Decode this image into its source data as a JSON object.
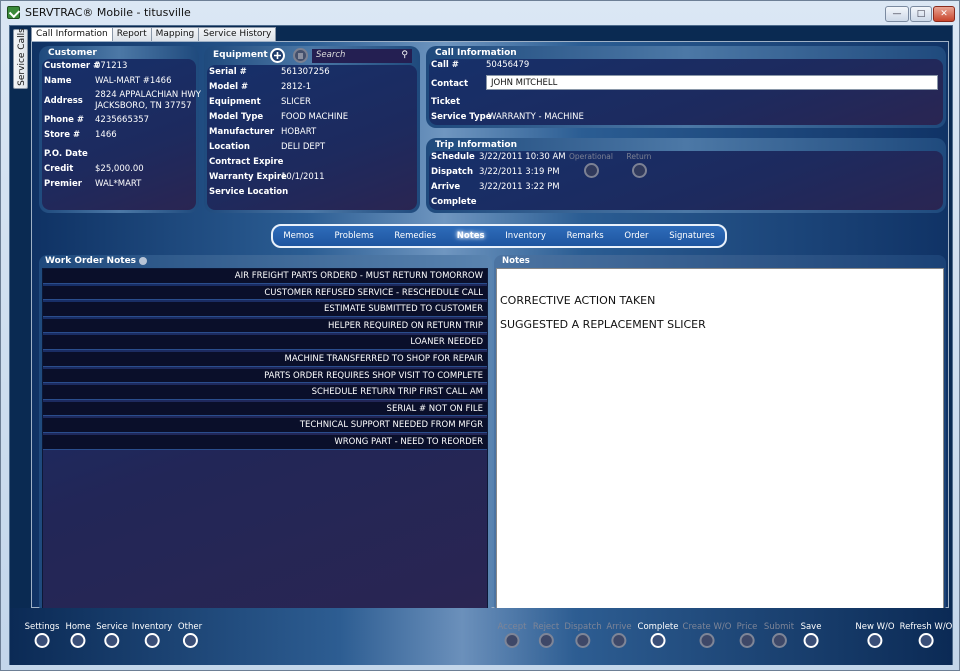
{
  "window": {
    "title": "SERVTRAC® Mobile - titusville",
    "controls": {
      "minimize": "—",
      "maximize": "□",
      "close": "✕"
    }
  },
  "side_tab": "Service Calls",
  "tabs": [
    {
      "label": "Call Information",
      "active": true
    },
    {
      "label": "Report",
      "active": false
    },
    {
      "label": "Mapping",
      "active": false
    },
    {
      "label": "Service History",
      "active": false
    }
  ],
  "customer": {
    "title": "Customer",
    "fields": [
      {
        "label": "Customer #",
        "value": "071213"
      },
      {
        "label": "Name",
        "value": "WAL-MART #1466"
      },
      {
        "label": "Address",
        "value": "2824 APPALACHIAN HWY",
        "value2": "JACKSBORO, TN 37757"
      },
      {
        "label": "Phone #",
        "value": "4235665357"
      },
      {
        "label": "Store #",
        "value": "1466"
      },
      {
        "label": "P.O. Date",
        "value": ""
      },
      {
        "label": "Credit",
        "value": "$25,000.00"
      },
      {
        "label": "Premier",
        "value": "WAL*MART"
      }
    ]
  },
  "equipment": {
    "title": "Equipment",
    "search_placeholder": "Search",
    "fields": [
      {
        "label": "Serial #",
        "value": "561307256"
      },
      {
        "label": "Model #",
        "value": "2812-1"
      },
      {
        "label": "Equipment",
        "value": "SLICER"
      },
      {
        "label": "Model Type",
        "value": "FOOD MACHINE"
      },
      {
        "label": "Manufacturer",
        "value": "HOBART"
      },
      {
        "label": "Location",
        "value": "DELI DEPT"
      },
      {
        "label": "Contract Expire",
        "value": ""
      },
      {
        "label": "Warranty Expire",
        "value": "10/1/2011"
      },
      {
        "label": "Service Location",
        "value": ""
      }
    ]
  },
  "call_information": {
    "title": "Call Information",
    "call_label": "Call #",
    "call_value": "50456479",
    "contact_label": "Contact",
    "contact_value": "JOHN MITCHELL",
    "ticket_label": "Ticket",
    "ticket_value": "",
    "service_type_label": "Service Type",
    "service_type_value": "WARRANTY - MACHINE"
  },
  "trip_information": {
    "title": "Trip Information",
    "fields": [
      {
        "label": "Schedule",
        "value": "3/22/2011 10:30 AM"
      },
      {
        "label": "Dispatch",
        "value": "3/22/2011 3:19 PM"
      },
      {
        "label": "Arrive",
        "value": "3/22/2011 3:22 PM"
      },
      {
        "label": "Complete",
        "value": ""
      }
    ],
    "operational_label": "Operational",
    "return_label": "Return"
  },
  "subnav": [
    {
      "label": "Memos",
      "active": false
    },
    {
      "label": "Problems",
      "active": false
    },
    {
      "label": "Remedies",
      "active": false
    },
    {
      "label": "Notes",
      "active": true
    },
    {
      "label": "Inventory",
      "active": false
    },
    {
      "label": "Remarks",
      "active": false
    },
    {
      "label": "Order",
      "active": false
    },
    {
      "label": "Signatures",
      "active": false
    }
  ],
  "work_order_notes": {
    "title": "Work Order Notes",
    "items": [
      "AIR FREIGHT PARTS ORDERD - MUST RETURN TOMORROW",
      "CUSTOMER REFUSED SERVICE - RESCHEDULE CALL",
      "ESTIMATE SUBMITTED TO CUSTOMER",
      "HELPER REQUIRED ON RETURN TRIP",
      "LOANER NEEDED",
      "MACHINE TRANSFERRED TO SHOP FOR REPAIR",
      "PARTS ORDER REQUIRES SHOP VISIT TO COMPLETE",
      "SCHEDULE RETURN TRIP FIRST CALL AM",
      "SERIAL # NOT ON FILE",
      "TECHNICAL SUPPORT NEEDED FROM MFGR",
      "WRONG PART - NEED TO REORDER"
    ]
  },
  "notes": {
    "title": "Notes",
    "lines": [
      "CORRECTIVE ACTION TAKEN",
      "SUGGESTED A REPLACEMENT SLICER"
    ]
  },
  "toolbar": {
    "left": [
      {
        "label": "Settings",
        "icon": "settings-icon"
      },
      {
        "label": "Home",
        "icon": "home-icon"
      },
      {
        "label": "Service",
        "icon": "service-icon"
      },
      {
        "label": "Inventory",
        "icon": "inventory-icon"
      },
      {
        "label": "Other",
        "icon": "other-icon"
      }
    ],
    "right": [
      {
        "label": "Accept",
        "enabled": false
      },
      {
        "label": "Reject",
        "enabled": false
      },
      {
        "label": "Dispatch",
        "enabled": false
      },
      {
        "label": "Arrive",
        "enabled": false
      },
      {
        "label": "Complete",
        "enabled": true
      },
      {
        "label": "Create W/O",
        "enabled": false
      },
      {
        "label": "Price",
        "enabled": false
      },
      {
        "label": "Submit",
        "enabled": false
      },
      {
        "label": "Save",
        "enabled": true
      },
      {
        "label": "New W/O",
        "enabled": true
      },
      {
        "label": "Refresh W/O",
        "enabled": true
      }
    ]
  }
}
